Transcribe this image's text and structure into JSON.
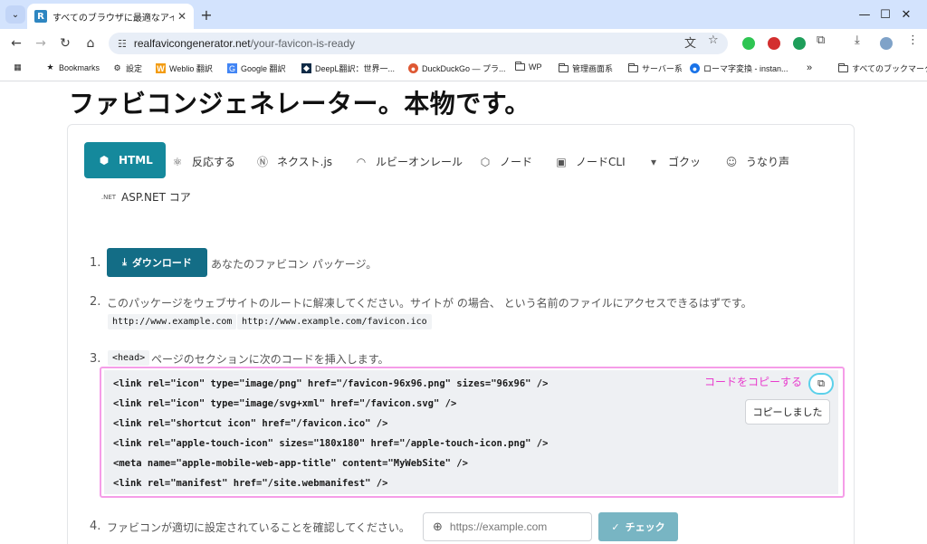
{
  "browser": {
    "tab_title": "すべてのブラウザに最適なアイコンを",
    "tab_favicon_letter": "R",
    "url_domain": "realfavicongenerator.net",
    "url_path": "/your-favicon-is-ready",
    "bookmarks": [
      {
        "label": "Bookmarks",
        "icon": "star-icon"
      },
      {
        "label": "設定",
        "icon": "gear-icon"
      },
      {
        "label": "Weblio 翻訳",
        "icon": "weblio-icon"
      },
      {
        "label": "Google 翻訳",
        "icon": "translate-icon"
      },
      {
        "label": "DeepL翻訳：世界一...",
        "icon": "deepl-icon"
      },
      {
        "label": "DuckDuckGo — プラ...",
        "icon": "duckduckgo-icon"
      },
      {
        "label": "WP",
        "icon": "folder-icon"
      },
      {
        "label": "管理画面系",
        "icon": "folder-icon"
      },
      {
        "label": "サーバー系",
        "icon": "folder-icon"
      },
      {
        "label": "ローマ字変換 - instan...",
        "icon": "romaji-icon"
      }
    ],
    "bookmarks_overflow": "»",
    "all_bookmarks": "すべてのブックマーク"
  },
  "page": {
    "title": "ファビコンジェネレーター。本物です。",
    "framework_tabs": [
      {
        "label": "HTML",
        "icon": "html5-icon",
        "active": true
      },
      {
        "label": "反応する",
        "icon": "react-icon"
      },
      {
        "label": "ネクスト.js",
        "icon": "nextjs-icon"
      },
      {
        "label": "ルビーオンレール",
        "icon": "rails-icon"
      },
      {
        "label": "ノード",
        "icon": "nodejs-icon"
      },
      {
        "label": "ノードCLI",
        "icon": "terminal-icon"
      },
      {
        "label": "ゴクッ",
        "icon": "gulp-icon"
      },
      {
        "label": "うなり声",
        "icon": "grunt-icon"
      },
      {
        "label": "ASP.NET コア",
        "icon": "dotnet-icon",
        "icon_text": ".NET"
      }
    ],
    "steps": {
      "s1_num": "1.",
      "download_label": "ダウンロード",
      "s1_text": "あなたのファビコン パッケージ。",
      "s2_num": "2.",
      "s2_text": "このパッケージをウェブサイトのルートに解凍してください。サイトが の場合、 という名前のファイルにアクセスできるはずです。",
      "s2_code1": "http://www.example.com",
      "s2_code2": "http://www.example.com/favicon.ico",
      "s3_num": "3.",
      "s3_code": "<head>",
      "s3_text": "ページのセクションに次のコードを挿入します。",
      "code_lines": [
        "<link rel=\"icon\" type=\"image/png\" href=\"/favicon-96x96.png\" sizes=\"96x96\" />",
        "<link rel=\"icon\" type=\"image/svg+xml\" href=\"/favicon.svg\" />",
        "<link rel=\"shortcut icon\" href=\"/favicon.ico\" />",
        "<link rel=\"apple-touch-icon\" sizes=\"180x180\" href=\"/apple-touch-icon.png\" />",
        "<meta name=\"apple-mobile-web-app-title\" content=\"MyWebSite\" />",
        "<link rel=\"manifest\" href=\"/site.webmanifest\" />"
      ],
      "copy_annotation": "コードをコピーする",
      "copied_label": "コピーしました",
      "s4_num": "4.",
      "s4_text": "ファビコンが適切に設定されていることを確認してください。",
      "url_placeholder": "https://example.com",
      "check_label": "チェック"
    }
  },
  "colors": {
    "accent": "#15899c",
    "download_button": "#136d86",
    "annotation_pink": "#e83ccd",
    "highlight_cyan": "#5bd0ea"
  }
}
